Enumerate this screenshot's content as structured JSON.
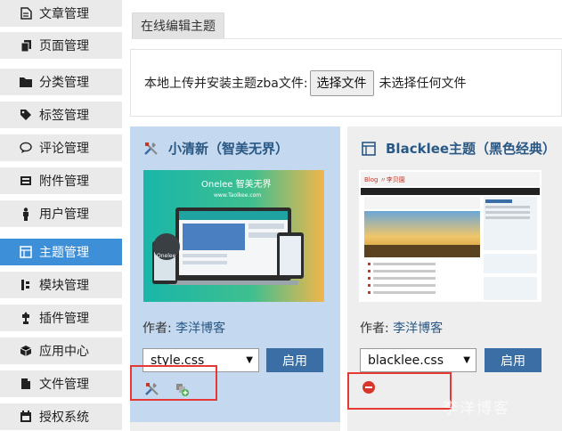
{
  "sidebar": {
    "items": [
      {
        "label": "文章管理",
        "icon": "document-icon",
        "active": false
      },
      {
        "label": "页面管理",
        "icon": "copy-icon",
        "active": false
      },
      {
        "label": "分类管理",
        "icon": "folder-icon",
        "active": false
      },
      {
        "label": "标签管理",
        "icon": "tag-icon",
        "active": false
      },
      {
        "label": "评论管理",
        "icon": "comment-icon",
        "active": false
      },
      {
        "label": "附件管理",
        "icon": "attachment-icon",
        "active": false
      },
      {
        "label": "用户管理",
        "icon": "user-icon",
        "active": false
      },
      {
        "label": "主题管理",
        "icon": "theme-icon",
        "active": true
      },
      {
        "label": "模块管理",
        "icon": "module-icon",
        "active": false
      },
      {
        "label": "插件管理",
        "icon": "plugin-icon",
        "active": false
      },
      {
        "label": "应用中心",
        "icon": "app-center-icon",
        "active": false
      },
      {
        "label": "文件管理",
        "icon": "file-icon",
        "active": false
      },
      {
        "label": "授权系统",
        "icon": "license-icon",
        "active": false
      }
    ]
  },
  "main": {
    "tab_label": "在线编辑主题",
    "upload": {
      "label": "本地上传并安装主题zba文件:",
      "button": "选择文件",
      "status": "未选择任何文件"
    },
    "themes": [
      {
        "name": "小清新（智美无界）",
        "author_prefix": "作者: ",
        "author": "李洋博客",
        "style": "style.css",
        "apply": "启用",
        "thumb_title": "Onelee 智美无界",
        "thumb_url": "www.Taolkee.com",
        "thumb_badge": "Onelee"
      },
      {
        "name": "Blacklee主题（黑色经典）",
        "author_prefix": "作者: ",
        "author": "李洋博客",
        "style": "blacklee.css",
        "apply": "启用",
        "thumb_site": "Blog 〃李贝園"
      }
    ]
  },
  "watermark": "李洋博客",
  "colors": {
    "sidebar_active": "#3d8fd7",
    "card_active_bg": "#c4d8ef",
    "card_bg": "#eeeeee",
    "title_color": "#2a5885",
    "apply_button": "#3a6ea5",
    "highlight_box": "#e53935"
  }
}
